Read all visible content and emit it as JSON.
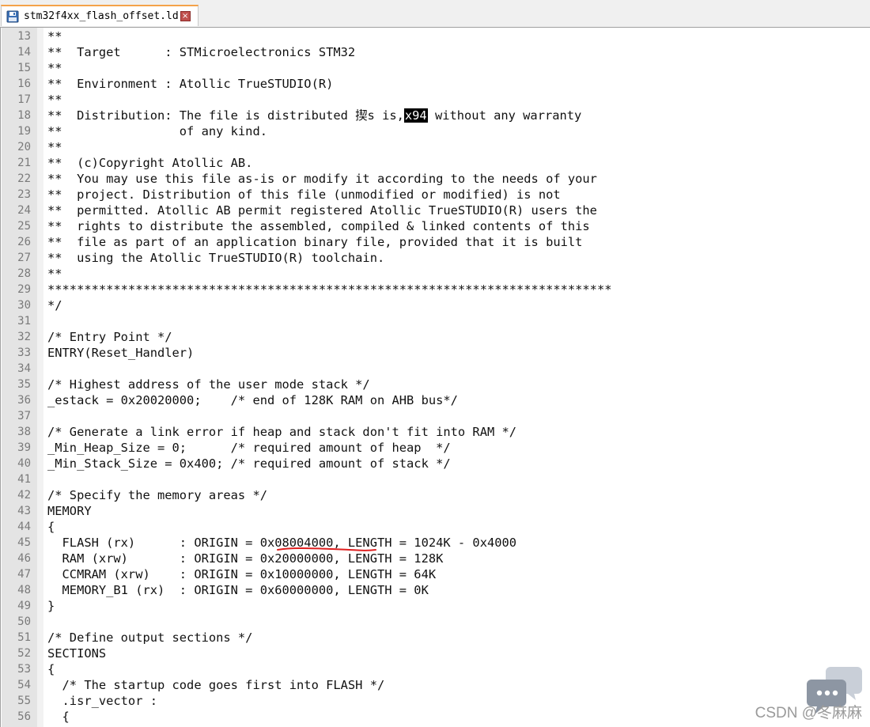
{
  "tab": {
    "filename": "stm32f4xx_flash_offset.ld",
    "close_glyph": "×"
  },
  "highlight_token": "x94",
  "lines": [
    {
      "n": "13",
      "pre": "**",
      "hl": "",
      "post": ""
    },
    {
      "n": "14",
      "pre": "**  Target      : STMicroelectronics STM32",
      "hl": "",
      "post": ""
    },
    {
      "n": "15",
      "pre": "**",
      "hl": "",
      "post": ""
    },
    {
      "n": "16",
      "pre": "**  Environment : Atollic TrueSTUDIO(R)",
      "hl": "",
      "post": ""
    },
    {
      "n": "17",
      "pre": "**",
      "hl": "",
      "post": ""
    },
    {
      "n": "18",
      "pre": "**  Distribution: The file is distributed 揳s is,",
      "hl": "x94",
      "post": " without any warranty"
    },
    {
      "n": "19",
      "pre": "**                of any kind.",
      "hl": "",
      "post": ""
    },
    {
      "n": "20",
      "pre": "**",
      "hl": "",
      "post": ""
    },
    {
      "n": "21",
      "pre": "**  (c)Copyright Atollic AB.",
      "hl": "",
      "post": ""
    },
    {
      "n": "22",
      "pre": "**  You may use this file as-is or modify it according to the needs of your",
      "hl": "",
      "post": ""
    },
    {
      "n": "23",
      "pre": "**  project. Distribution of this file (unmodified or modified) is not",
      "hl": "",
      "post": ""
    },
    {
      "n": "24",
      "pre": "**  permitted. Atollic AB permit registered Atollic TrueSTUDIO(R) users the",
      "hl": "",
      "post": ""
    },
    {
      "n": "25",
      "pre": "**  rights to distribute the assembled, compiled & linked contents of this",
      "hl": "",
      "post": ""
    },
    {
      "n": "26",
      "pre": "**  file as part of an application binary file, provided that it is built",
      "hl": "",
      "post": ""
    },
    {
      "n": "27",
      "pre": "**  using the Atollic TrueSTUDIO(R) toolchain.",
      "hl": "",
      "post": ""
    },
    {
      "n": "28",
      "pre": "**",
      "hl": "",
      "post": ""
    },
    {
      "n": "29",
      "pre": "*****************************************************************************",
      "hl": "",
      "post": ""
    },
    {
      "n": "30",
      "pre": "*/",
      "hl": "",
      "post": ""
    },
    {
      "n": "31",
      "pre": "",
      "hl": "",
      "post": ""
    },
    {
      "n": "32",
      "pre": "/* Entry Point */",
      "hl": "",
      "post": ""
    },
    {
      "n": "33",
      "pre": "ENTRY(Reset_Handler)",
      "hl": "",
      "post": ""
    },
    {
      "n": "34",
      "pre": "",
      "hl": "",
      "post": ""
    },
    {
      "n": "35",
      "pre": "/* Highest address of the user mode stack */",
      "hl": "",
      "post": ""
    },
    {
      "n": "36",
      "pre": "_estack = 0x20020000;    /* end of 128K RAM on AHB bus*/",
      "hl": "",
      "post": ""
    },
    {
      "n": "37",
      "pre": "",
      "hl": "",
      "post": ""
    },
    {
      "n": "38",
      "pre": "/* Generate a link error if heap and stack don't fit into RAM */",
      "hl": "",
      "post": ""
    },
    {
      "n": "39",
      "pre": "_Min_Heap_Size = 0;      /* required amount of heap  */",
      "hl": "",
      "post": ""
    },
    {
      "n": "40",
      "pre": "_Min_Stack_Size = 0x400; /* required amount of stack */",
      "hl": "",
      "post": ""
    },
    {
      "n": "41",
      "pre": "",
      "hl": "",
      "post": ""
    },
    {
      "n": "42",
      "pre": "/* Specify the memory areas */",
      "hl": "",
      "post": ""
    },
    {
      "n": "43",
      "pre": "MEMORY",
      "hl": "",
      "post": ""
    },
    {
      "n": "44",
      "pre": "{",
      "hl": "",
      "post": ""
    },
    {
      "n": "45",
      "pre": "  FLASH (rx)      : ORIGIN = 0x08004000, LENGTH = 1024K - 0x4000",
      "hl": "",
      "post": "",
      "underlined": true
    },
    {
      "n": "46",
      "pre": "  RAM (xrw)       : ORIGIN = 0x20000000, LENGTH = 128K",
      "hl": "",
      "post": ""
    },
    {
      "n": "47",
      "pre": "  CCMRAM (xrw)    : ORIGIN = 0x10000000, LENGTH = 64K",
      "hl": "",
      "post": ""
    },
    {
      "n": "48",
      "pre": "  MEMORY_B1 (rx)  : ORIGIN = 0x60000000, LENGTH = 0K",
      "hl": "",
      "post": ""
    },
    {
      "n": "49",
      "pre": "}",
      "hl": "",
      "post": ""
    },
    {
      "n": "50",
      "pre": "",
      "hl": "",
      "post": ""
    },
    {
      "n": "51",
      "pre": "/* Define output sections */",
      "hl": "",
      "post": ""
    },
    {
      "n": "52",
      "pre": "SECTIONS",
      "hl": "",
      "post": ""
    },
    {
      "n": "53",
      "pre": "{",
      "hl": "",
      "post": ""
    },
    {
      "n": "54",
      "pre": "  /* The startup code goes first into FLASH */",
      "hl": "",
      "post": ""
    },
    {
      "n": "55",
      "pre": "  .isr_vector :",
      "hl": "",
      "post": ""
    },
    {
      "n": "56",
      "pre": "  {",
      "hl": "",
      "post": ""
    }
  ],
  "annotation": {
    "underline_color": "#e02020"
  },
  "watermark": {
    "text": "CSDN @冬麻麻"
  },
  "colors": {
    "gutter_bg": "#e4e4e4",
    "line_number": "#7a7a7a",
    "code_text": "#111111",
    "tab_accent": "#f4a24a"
  }
}
